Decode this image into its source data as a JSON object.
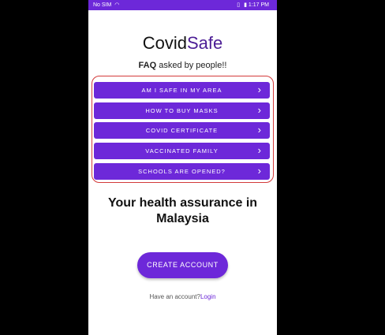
{
  "status_bar": {
    "carrier": "No SIM",
    "wifi_icon": "wifi-icon",
    "time": "1:17 PM"
  },
  "app": {
    "title_part1": "Covid",
    "title_part2": "Safe",
    "faq_bold": "FAQ",
    "faq_rest": " asked by people!!"
  },
  "faq_items": [
    {
      "label": "AM I SAFE IN MY AREA"
    },
    {
      "label": "HOW TO BUY MASKS"
    },
    {
      "label": "COVID CERTIFICATE"
    },
    {
      "label": "VACCINATED FAMILY"
    },
    {
      "label": "SCHOOLS ARE OPENED?"
    }
  ],
  "tagline": {
    "line1": "Your health assurance in",
    "line2": "Malaysia"
  },
  "create_account_label": "CREATE ACCOUNT",
  "login": {
    "prompt": "Have an account?",
    "link": "Login"
  },
  "colors": {
    "accent": "#6d28d9",
    "highlight_border": "#d33a3a"
  }
}
